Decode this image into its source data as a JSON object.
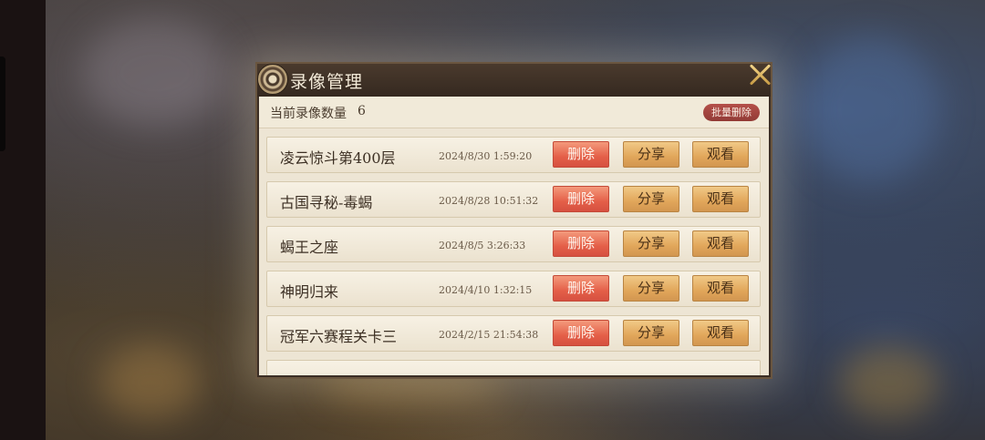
{
  "dialog": {
    "title": "录像管理",
    "count_label": "当前录像数量",
    "count_value": "6",
    "batch_delete_label": "批量删除"
  },
  "recordings": [
    {
      "name": "凌云惊斗第400层",
      "date": "2024/8/30 1:59:20",
      "delete": "删除",
      "share": "分享",
      "watch": "观看"
    },
    {
      "name": "古国寻秘-毒蝎",
      "date": "2024/8/28 10:51:32",
      "delete": "删除",
      "share": "分享",
      "watch": "观看"
    },
    {
      "name": "蝎王之座",
      "date": "2024/8/5 3:26:33",
      "delete": "删除",
      "share": "分享",
      "watch": "观看"
    },
    {
      "name": "神明归来",
      "date": "2024/4/10 1:32:15",
      "delete": "删除",
      "share": "分享",
      "watch": "观看"
    },
    {
      "name": "冠军六赛程关卡三",
      "date": "2024/2/15 21:54:38",
      "delete": "删除",
      "share": "分享",
      "watch": "观看"
    }
  ],
  "icons": {
    "emblem": "emblem-icon",
    "close": "close-icon"
  },
  "colors": {
    "delete_button": "#e45f48",
    "action_button": "#e1a65a",
    "batch_delete": "#923a35",
    "close_icon": "#e6bc6a"
  }
}
